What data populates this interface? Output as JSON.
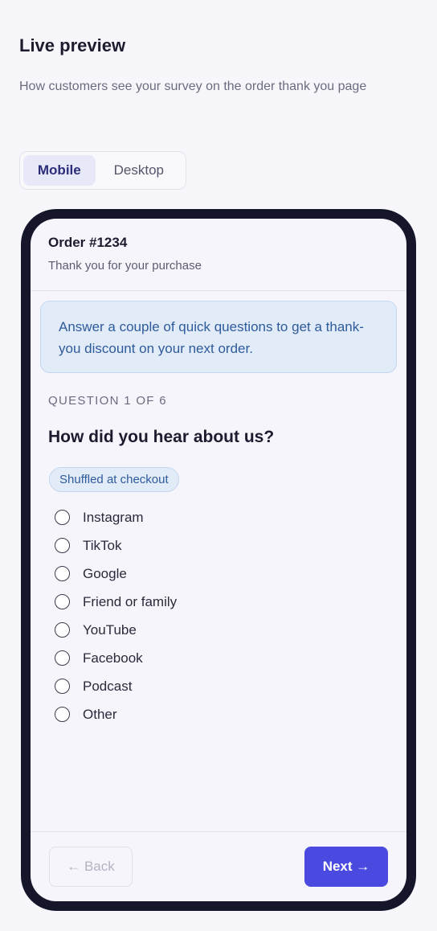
{
  "panel": {
    "title": "Live preview",
    "description": "How customers see your survey on the order thank you page"
  },
  "toggle": {
    "mobile_label": "Mobile",
    "desktop_label": "Desktop",
    "selected": "Mobile"
  },
  "preview": {
    "order_title": "Order #1234",
    "order_subtitle": "Thank you for your purchase",
    "banner_text": "Answer a couple of quick questions to get a thank-you discount on your next order.",
    "question_counter": "QUESTION 1 OF 6",
    "question_title": "How did you hear about us?",
    "chip_label": "Shuffled at checkout",
    "options": [
      {
        "label": "Instagram"
      },
      {
        "label": "TikTok"
      },
      {
        "label": "Google"
      },
      {
        "label": "Friend or family"
      },
      {
        "label": "YouTube"
      },
      {
        "label": "Facebook"
      },
      {
        "label": "Podcast"
      },
      {
        "label": "Other"
      }
    ],
    "back_label": "← Back",
    "next_label": "Next →"
  },
  "colors": {
    "accent": "#4a4ae0",
    "phone_frame": "#16162b",
    "banner_bg": "#e2ebf8",
    "banner_text": "#2e5b9b"
  }
}
